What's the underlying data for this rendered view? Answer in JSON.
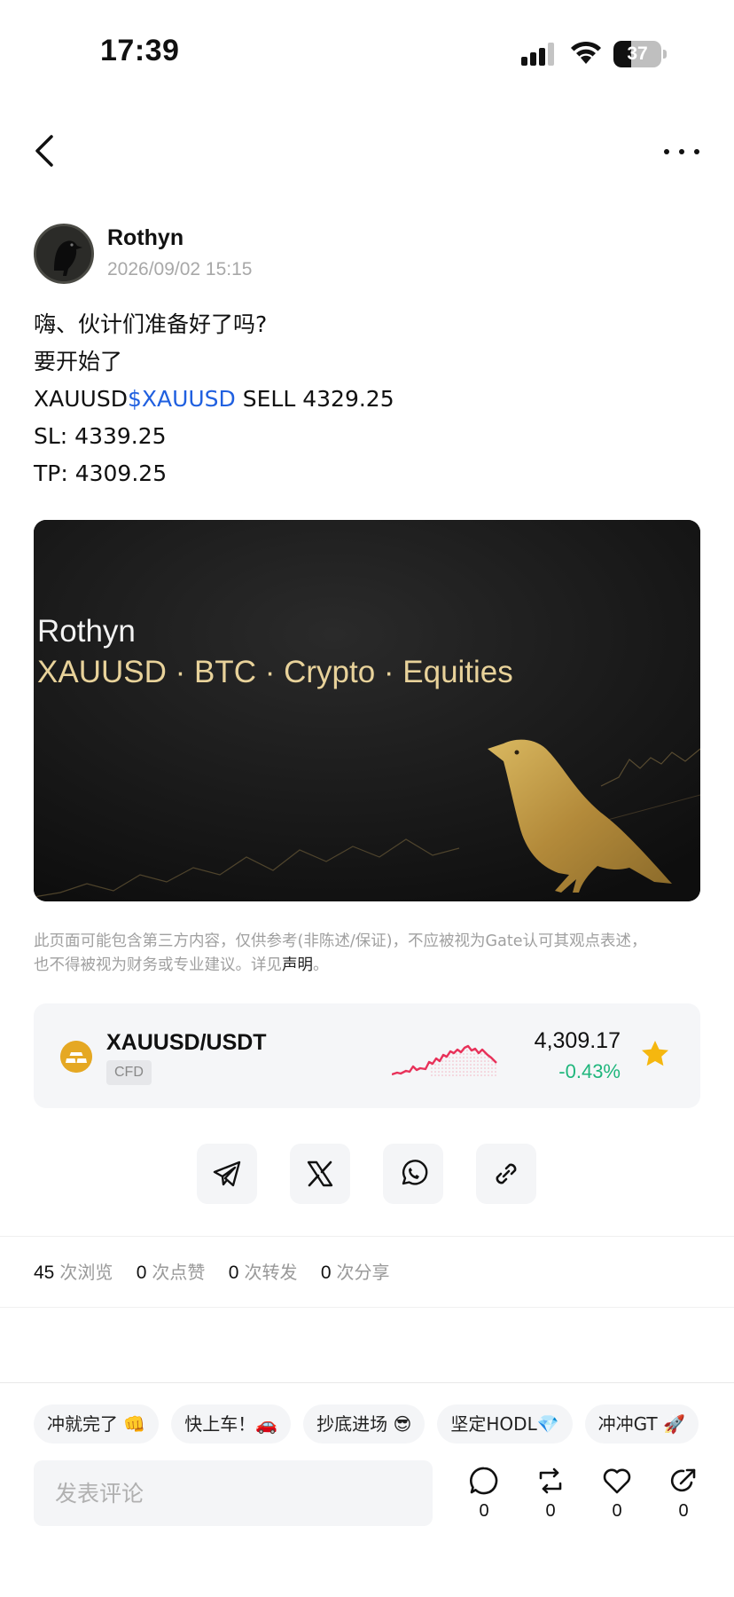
{
  "status_bar": {
    "time": "17:39",
    "battery": "37",
    "battery_level": 0.37
  },
  "nav": {
    "back_icon": "chevron-left-icon",
    "more_icon": "ellipsis-icon"
  },
  "author": {
    "name": "Rothyn",
    "timestamp": "2026/09/02 15:15"
  },
  "post": {
    "line1": "嗨、伙计们准备好了吗?",
    "line2": "要开始了",
    "line3_prefix": "XAUUSD",
    "line3_link": "$XAUUSD",
    "line3_suffix": " SELL 4329.25",
    "line4": "SL:  4339.25",
    "line5": "TP:  4309.25"
  },
  "banner": {
    "title": "Rothyn",
    "subtitle": "XAUUSD · BTC · Crypto · Equities"
  },
  "disclaimer": {
    "line1": "此页面可能包含第三方内容，仅供参考(非陈述/保证)，不应被视为Gate认可其观点表述，",
    "line2_prefix": "也不得被视为财务或专业建议。详见",
    "link": "声明",
    "line2_suffix": "。"
  },
  "market": {
    "pair": "XAUUSD/USDT",
    "badge": "CFD",
    "price": "4,309.17",
    "change": "-0.43%",
    "change_color": "#1fb67c",
    "sparkline_color": "#e8325a",
    "favorited": true
  },
  "share_buttons": [
    "telegram-icon",
    "x-icon",
    "whatsapp-icon",
    "link-icon"
  ],
  "stats": {
    "views": "45",
    "views_label": "次浏览",
    "likes": "0",
    "likes_label": "次点赞",
    "reposts": "0",
    "reposts_label": "次转发",
    "shares": "0",
    "shares_label": "次分享"
  },
  "quick_replies": [
    "冲就完了 👊",
    "快上车！🚗",
    "抄底进场 😎",
    "坚定HODL💎",
    "冲冲GT 🚀"
  ],
  "comment_bar": {
    "placeholder": "发表评论",
    "comment_count": "0",
    "repost_count": "0",
    "like_count": "0",
    "share_count": "0"
  }
}
